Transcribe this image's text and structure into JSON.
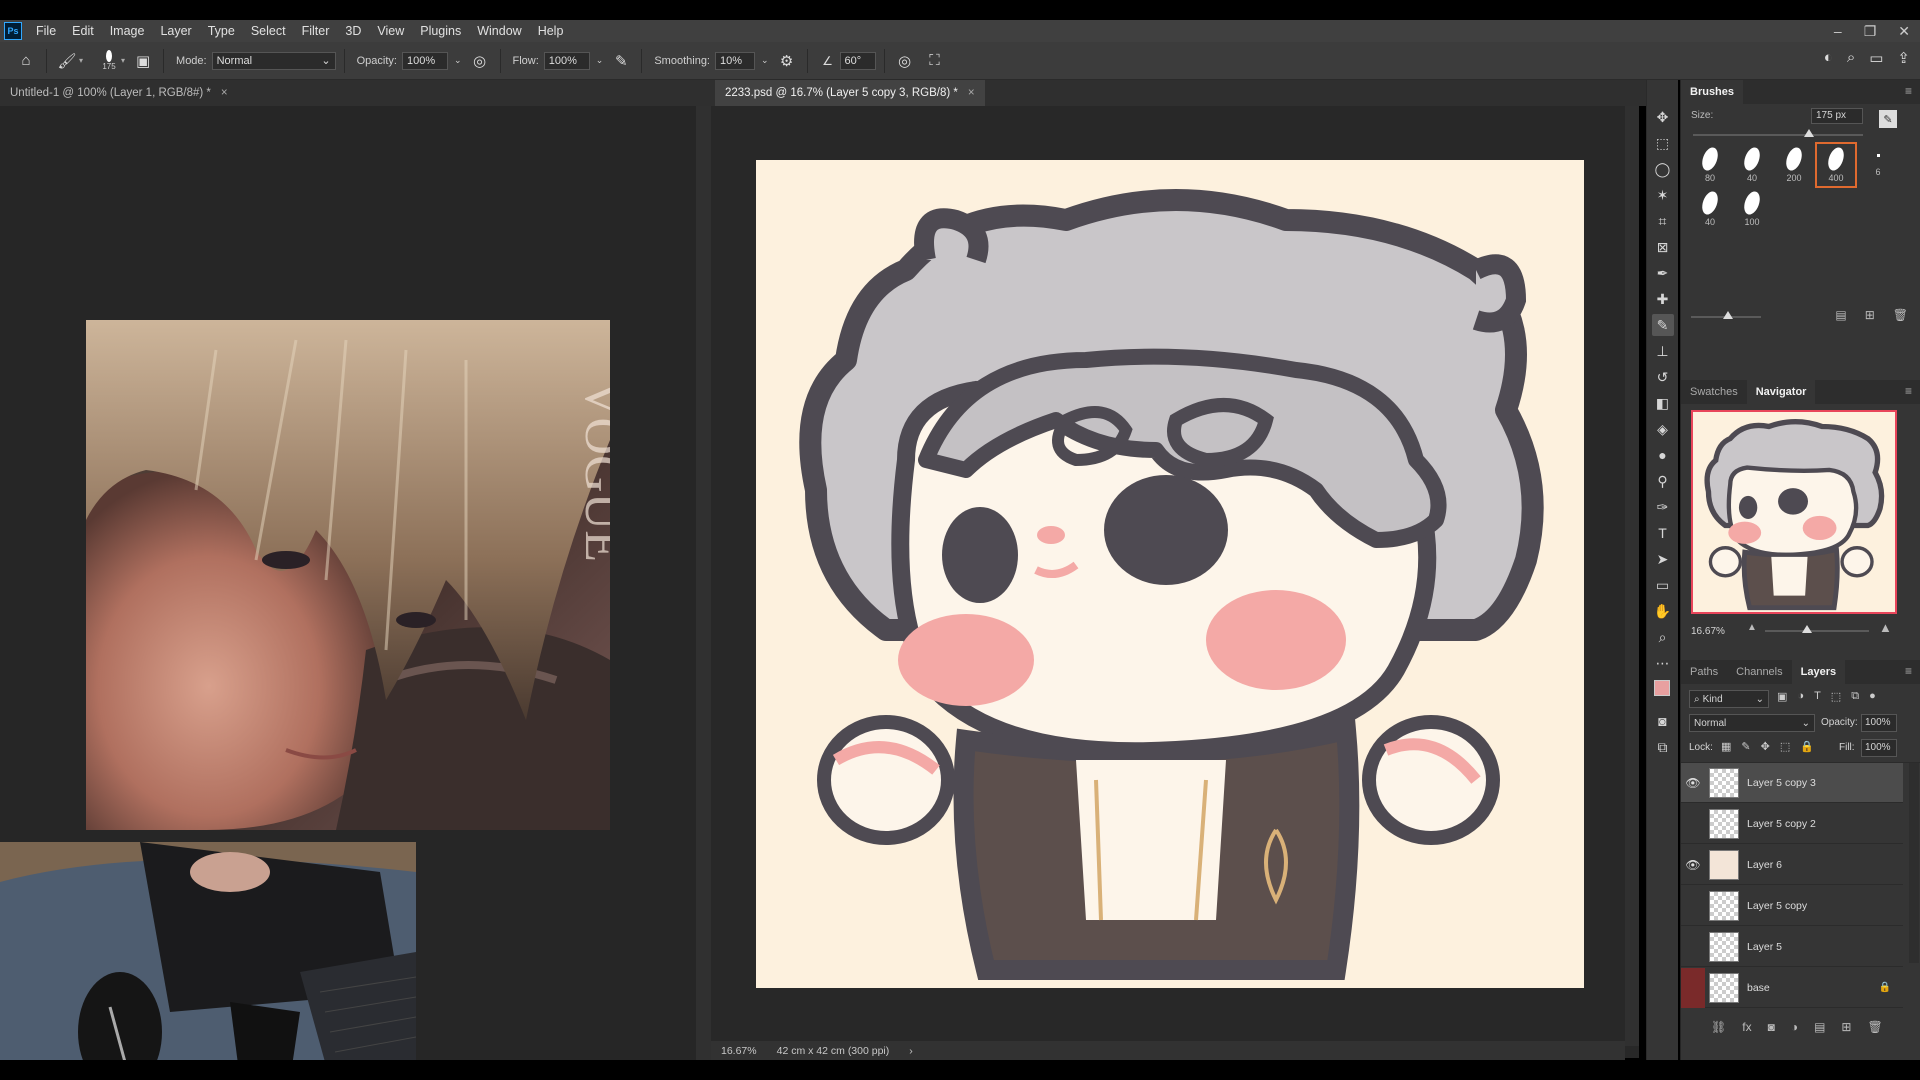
{
  "menubar": {
    "items": [
      "File",
      "Edit",
      "Image",
      "Layer",
      "Type",
      "Select",
      "Filter",
      "3D",
      "View",
      "Plugins",
      "Window",
      "Help"
    ],
    "window_controls": [
      "–",
      "❐",
      "✕"
    ]
  },
  "options": {
    "brush_size": "175",
    "mode_label": "Mode:",
    "mode_value": "Normal",
    "opacity_label": "Opacity:",
    "opacity_value": "100%",
    "flow_label": "Flow:",
    "flow_value": "100%",
    "smoothing_label": "Smoothing:",
    "smoothing_value": "10%",
    "angle_value": "60°"
  },
  "tabs": [
    {
      "label": "Untitled-1 @ 100% (Layer 1, RGB/8#) *",
      "close": "×"
    },
    {
      "label": "2233.psd @ 16.7% (Layer 5 copy 3, RGB/8) *",
      "close": "×"
    }
  ],
  "status": {
    "zoom": "16.67%",
    "doc_size": "42 cm x 42 cm (300 ppi)",
    "arrow": "›"
  },
  "brushes": {
    "title": "Brushes",
    "size_label": "Size:",
    "size_value": "175 px",
    "size_level": 0.68,
    "presets": [
      "80",
      "40",
      "200",
      "400",
      "6",
      "40",
      "100"
    ]
  },
  "navigator": {
    "tabs": [
      "Swatches",
      "Navigator"
    ],
    "zoom": "16.67%",
    "zoom_level": 0.4
  },
  "layers": {
    "tabs": [
      "Paths",
      "Channels",
      "Layers"
    ],
    "filter_kind": "Kind",
    "blend_mode": "Normal",
    "opacity_label": "Opacity:",
    "opacity_value": "100%",
    "lock_label": "Lock:",
    "fill_label": "Fill:",
    "fill_value": "100%",
    "rows": [
      {
        "name": "Layer 5 copy 3",
        "visible": true
      },
      {
        "name": "Layer 5 copy 2",
        "visible": false
      },
      {
        "name": "Layer 6",
        "visible": true
      },
      {
        "name": "Layer 5 copy",
        "visible": false
      },
      {
        "name": "Layer 5",
        "visible": false
      },
      {
        "name": "base",
        "visible": false
      }
    ]
  },
  "photo_watermark": "VOGUE",
  "colors": {
    "accent": "#e06a2f",
    "ps_blue": "#31a8ff",
    "foreground": "#e8a0a0",
    "background": "#000000"
  }
}
